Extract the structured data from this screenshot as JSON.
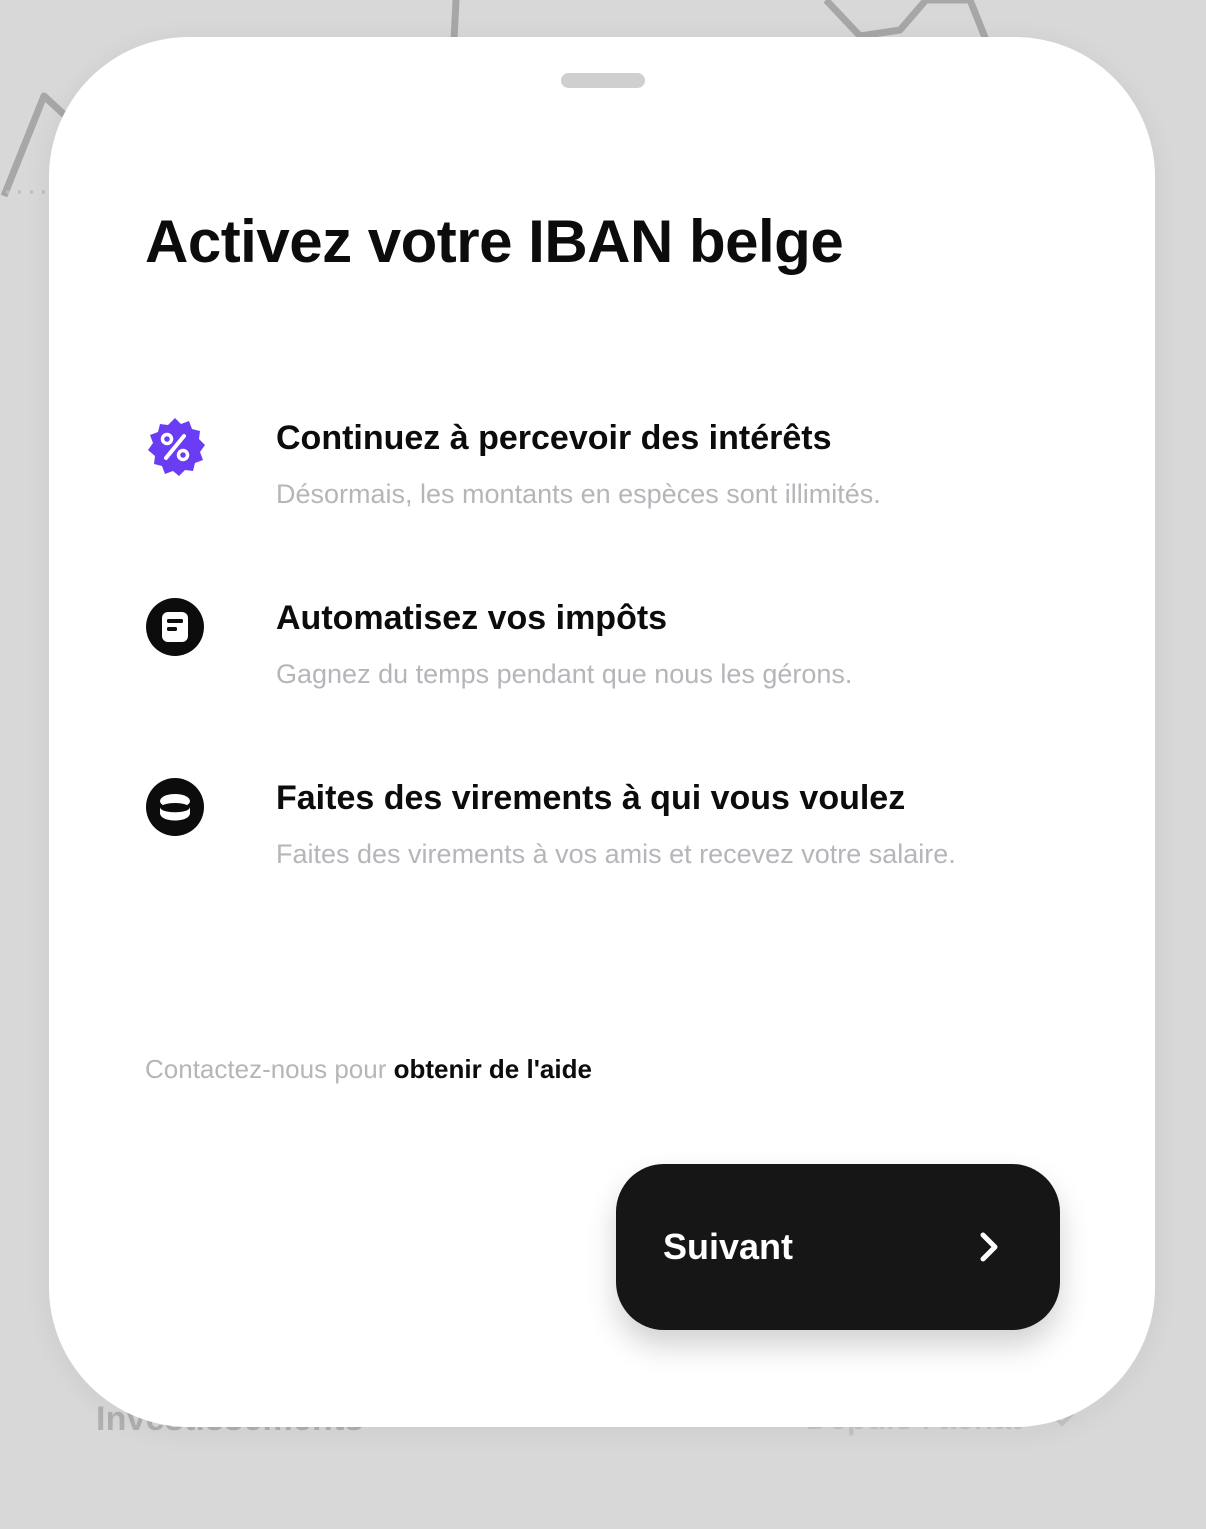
{
  "background": {
    "left_label": "Investissements",
    "right_label": "Depuis l'achat"
  },
  "sheet": {
    "title": "Activez votre IBAN belge",
    "features": [
      {
        "icon": "percent-badge-icon",
        "title": "Continuez à percevoir des intérêts",
        "description": "Désormais, les montants en espèces sont illimités."
      },
      {
        "icon": "document-circle-icon",
        "title": "Automatisez vos impôts",
        "description": "Gagnez du temps pendant que nous les gérons."
      },
      {
        "icon": "coin-stack-icon",
        "title": "Faites des virements à qui vous voulez",
        "description": "Faites des virements à vos amis et recevez votre salaire."
      }
    ],
    "help": {
      "prefix": "Contactez-nous pour ",
      "link": "obtenir de l'aide"
    },
    "next_button": {
      "label": "Suivant",
      "icon": "chevron-right-icon"
    }
  },
  "colors": {
    "accent": "#6a3df5",
    "button_bg": "#161616",
    "muted_text": "#b5b6ba",
    "backdrop": "#d8d8d8"
  }
}
